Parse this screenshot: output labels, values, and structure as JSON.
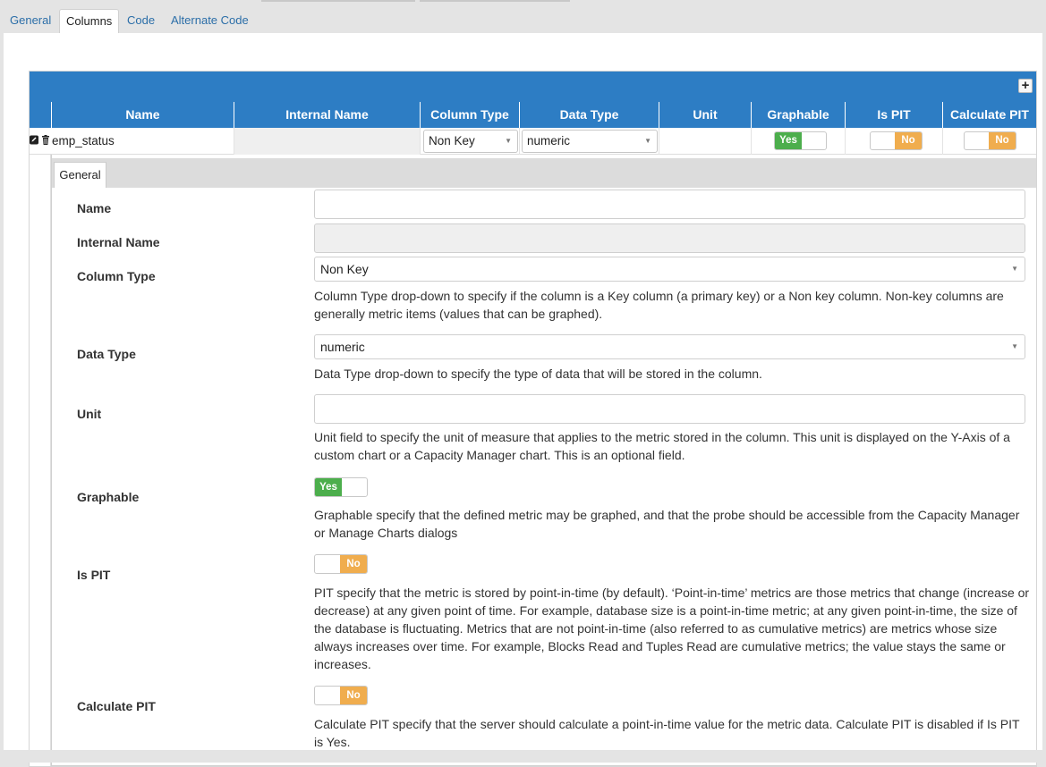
{
  "tabs": [
    "General",
    "Columns",
    "Code",
    "Alternate Code"
  ],
  "colors": {
    "header_blue": "#2d7dc4",
    "toggle_yes": "#4cae4c",
    "toggle_no": "#f0ad4e",
    "link_blue": "#2b6ea8"
  },
  "grid": {
    "add_icon": "+",
    "columns": [
      "Name",
      "Internal Name",
      "Column Type",
      "Data Type",
      "Unit",
      "Graphable",
      "Is PIT",
      "Calculate PIT"
    ],
    "row": {
      "edit_icon": "edit-icon",
      "delete_icon": "trash-icon",
      "name": "emp_status",
      "internal_name": "",
      "column_type": "Non Key",
      "data_type": "numeric",
      "unit": "",
      "graphable": "Yes",
      "is_pit": "No",
      "calculate_pit": "No"
    }
  },
  "detail": {
    "tab": "General",
    "fields": {
      "name": {
        "label": "Name",
        "value": ""
      },
      "internal_name": {
        "label": "Internal Name",
        "value": ""
      },
      "column_type": {
        "label": "Column Type",
        "value": "Non Key",
        "help": "Column Type drop-down to specify if the column is a Key column (a primary key) or a Non key column. Non-key columns are generally metric items (values that can be graphed)."
      },
      "data_type": {
        "label": "Data Type",
        "value": "numeric",
        "help": "Data Type drop-down to specify the type of data that will be stored in the column."
      },
      "unit": {
        "label": "Unit",
        "value": "",
        "help": "Unit field to specify the unit of measure that applies to the metric stored in the column. This unit is displayed on the Y-Axis of a custom chart or a Capacity Manager chart. This is an optional field."
      },
      "graphable": {
        "label": "Graphable",
        "value": "Yes",
        "help": "Graphable specify that the defined metric may be graphed, and that the probe should be accessible from the Capacity Manager or Manage Charts dialogs"
      },
      "is_pit": {
        "label": "Is PIT",
        "value": "No",
        "help": "PIT specify that the metric is stored by point-in-time (by default). ‘Point-in-time’ metrics are those metrics that change (increase or decrease) at any given point of time. For example, database size is a point-in-time metric; at any given point-in-time, the size of the database is fluctuating. Metrics that are not point-in-time (also referred to as cumulative metrics) are metrics whose size always increases over time. For example, Blocks Read and Tuples Read are cumulative metrics; the value stays the same or increases."
      },
      "calculate_pit": {
        "label": "Calculate PIT",
        "value": "No",
        "help": "Calculate PIT specify that the server should calculate a point-in-time value for the metric data. Calculate PIT is disabled if Is PIT is Yes."
      }
    }
  }
}
